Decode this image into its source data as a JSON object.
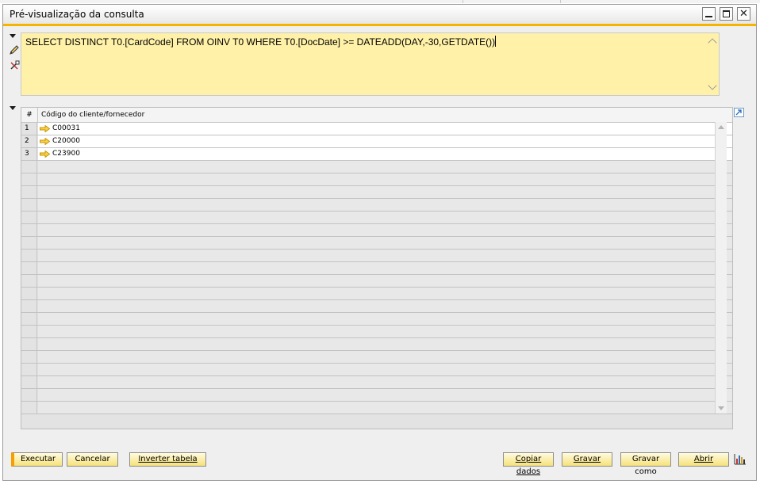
{
  "window": {
    "title": "Pré-visualização da consulta",
    "controls": [
      "minimize-icon",
      "maximize-icon",
      "close-icon"
    ],
    "close_glyph": "✕"
  },
  "query": {
    "text": "SELECT DISTINCT T0.[CardCode] FROM OINV T0 WHERE T0.[DocDate] >= DATEADD(DAY,-30,GETDATE())"
  },
  "grid": {
    "header_num": "#",
    "column": "Código do cliente/fornecedor",
    "rows": [
      {
        "num": "1",
        "value": "C00031"
      },
      {
        "num": "2",
        "value": "C20000"
      },
      {
        "num": "3",
        "value": "C23900"
      }
    ]
  },
  "buttons": {
    "execute": "Executar",
    "cancel": "Cancelar",
    "invert": "Inverter tabela",
    "copy": "Copiar dados",
    "save": "Gravar",
    "save_as": "Gravar como",
    "open": "Abrir"
  },
  "colors": {
    "accent": "#f5b400",
    "query_bg": "#fff2a8",
    "button_bg": "#f6e27a"
  }
}
